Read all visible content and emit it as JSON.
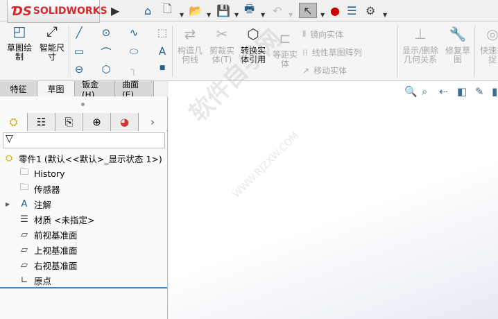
{
  "app": {
    "logo": "SOLIDWORKS"
  },
  "ribbon": {
    "sketch": "草图绘制",
    "smart_dim": "智能尺寸",
    "construction": "构造几何线",
    "trim": "剪裁实体(T)",
    "convert": "转换实体引用",
    "offset": "等距实体",
    "mirror": "镜向实体",
    "linear_pattern": "线性草图阵列",
    "move": "移动实体",
    "display_relations": "显示/删除几何关系",
    "repair": "修复草图",
    "quick_snap": "快速捕捉"
  },
  "tabs": [
    {
      "label": "特征"
    },
    {
      "label": "草图"
    },
    {
      "label": "钣金(H)"
    },
    {
      "label": "曲面(E)"
    }
  ],
  "tree": {
    "root": "零件1  (默认<<默认>_显示状态 1>)",
    "items": [
      {
        "label": "History"
      },
      {
        "label": "传感器"
      },
      {
        "label": "注解"
      },
      {
        "label": "材质 <未指定>"
      },
      {
        "label": "前视基准面"
      },
      {
        "label": "上视基准面"
      },
      {
        "label": "右视基准面"
      },
      {
        "label": "原点"
      }
    ]
  },
  "watermark": {
    "text": "软件自学网",
    "url": "WWW.RJZXW.COM"
  }
}
